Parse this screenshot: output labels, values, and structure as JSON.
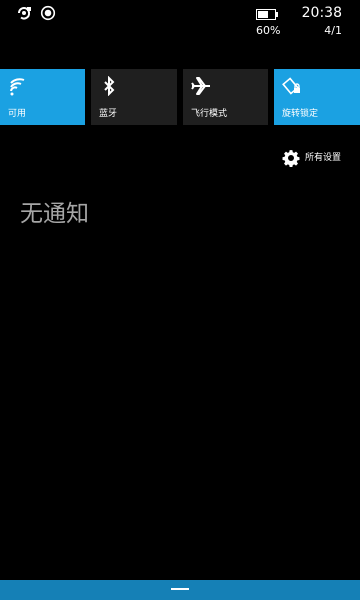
{
  "status_bar": {
    "left_icons": [
      "sync-icon",
      "record-icon"
    ],
    "time": "20:38",
    "battery_percent": "60%",
    "battery_level": 0.6,
    "date": "4/1"
  },
  "quick_actions": [
    {
      "label": "可用",
      "icon": "wifi-icon",
      "state": "on"
    },
    {
      "label": "蓝牙",
      "icon": "bluetooth-icon",
      "state": "off"
    },
    {
      "label": "飞行模式",
      "icon": "airplane-icon",
      "state": "off"
    },
    {
      "label": "旋转锁定",
      "icon": "rotation-lock-icon",
      "state": "on"
    }
  ],
  "settings_link": {
    "label": "所有设置",
    "icon": "gear-icon"
  },
  "notifications": {
    "empty_message": "无通知"
  },
  "colors": {
    "background": "#000000",
    "accent": "#1ba1e2",
    "tile_off": "#1f1f1f",
    "bottom_bar": "#1580b6",
    "muted_text": "#a6a6a6"
  }
}
